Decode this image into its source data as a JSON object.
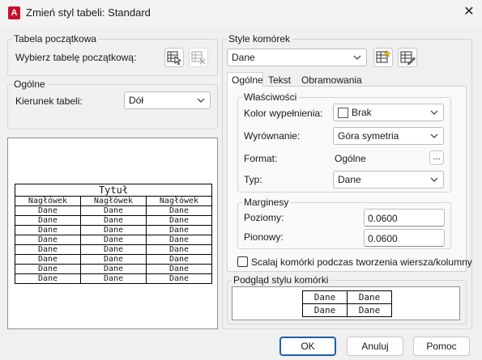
{
  "window": {
    "title": "Zmień styl tabeli: Standard",
    "app_icon_letter": "A",
    "close_glyph": "✕"
  },
  "starting_table": {
    "group_title": "Tabela początkowa",
    "label": "Wybierz tabelę początkową:"
  },
  "general": {
    "group_title": "Ogólne",
    "direction_label": "Kierunek tabeli:",
    "direction_value": "Dół"
  },
  "table_preview": {
    "title": "Tytuł",
    "headers": [
      "Nagłówek",
      "Nagłówek",
      "Nagłówek"
    ],
    "data_cell": "Dane",
    "data_rows": 8
  },
  "cell_styles": {
    "group_title": "Style komórek",
    "selected": "Dane",
    "tabs": [
      "Ogólne",
      "Tekst",
      "Obramowania"
    ],
    "active_tab": 0,
    "properties": {
      "group_title": "Właściwości",
      "fill_color_label": "Kolor wypełnienia:",
      "fill_color_value": "Brak",
      "alignment_label": "Wyrównanie:",
      "alignment_value": "Góra symetria",
      "format_label": "Format:",
      "format_value": "Ogólne",
      "format_button": "...",
      "type_label": "Typ:",
      "type_value": "Dane"
    },
    "margins": {
      "group_title": "Marginesy",
      "horizontal_label": "Poziomy:",
      "horizontal_value": "0.0600",
      "vertical_label": "Pionowy:",
      "vertical_value": "0.0600"
    },
    "merge_checkbox_label": "Scalaj komórki podczas tworzenia wiersza/kolumny",
    "merge_checked": false
  },
  "cell_style_preview": {
    "group_title": "Podgląd stylu komórki",
    "cell": "Dane"
  },
  "buttons": {
    "ok": "OK",
    "cancel": "Anuluj",
    "help": "Pomoc"
  },
  "icons": {
    "select_table": "select-table-icon",
    "edit_table": "remove-table-icon",
    "new_cell_style": "new-cell-style-icon",
    "manage_cell_styles": "manage-cell-styles-icon",
    "dropdown": "chevron-down-icon"
  },
  "colors": {
    "accent": "#1f5fa8",
    "app_icon": "#c8102e"
  }
}
